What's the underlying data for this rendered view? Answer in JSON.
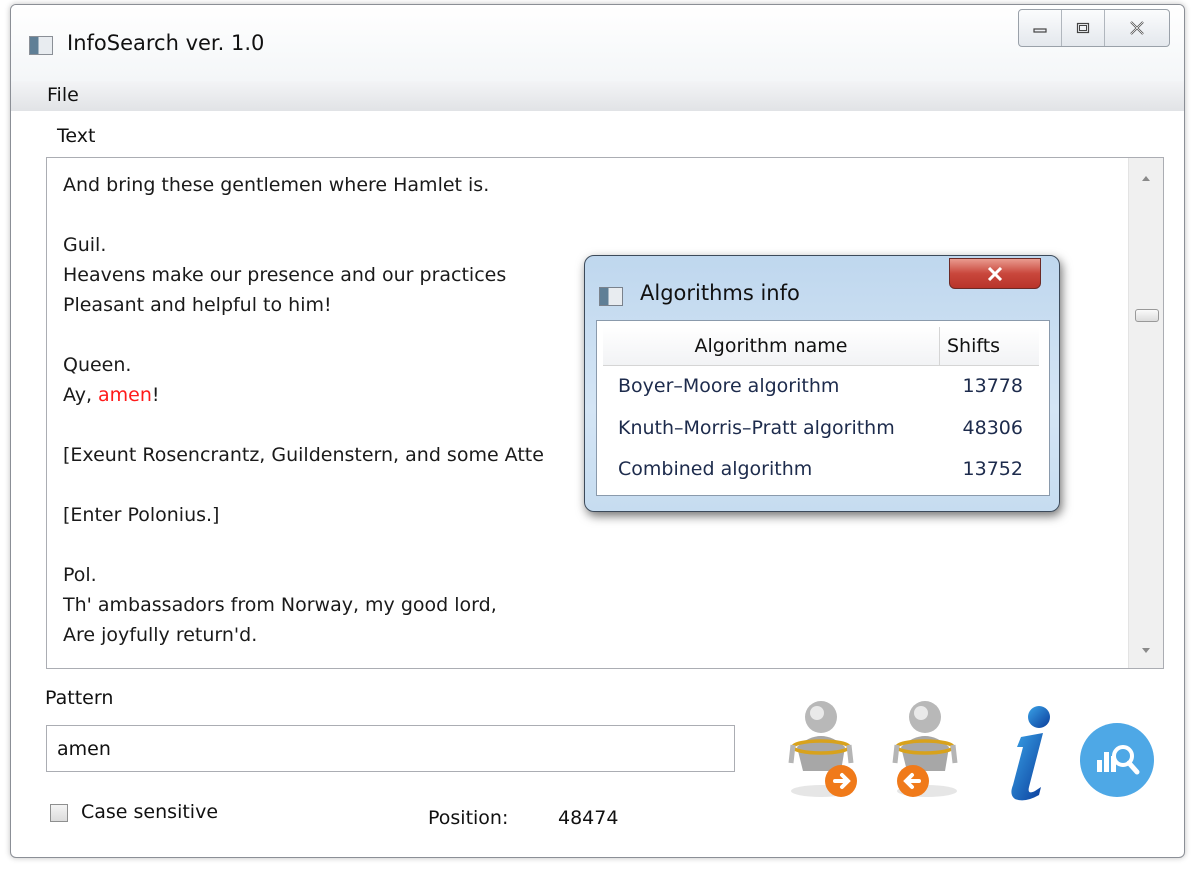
{
  "window": {
    "title": "InfoSearch ver. 1.0",
    "icons": [
      "app-icon",
      "minimize-icon",
      "maximize-icon",
      "close-icon"
    ]
  },
  "menu": {
    "file_label": "File"
  },
  "text_panel": {
    "label": "Text",
    "lines": [
      {
        "text": "And bring these gentlemen where Hamlet is."
      },
      {
        "text": ""
      },
      {
        "text": "Guil."
      },
      {
        "text": "Heavens make our presence and our practices"
      },
      {
        "text": "Pleasant and helpful to him!"
      },
      {
        "text": ""
      },
      {
        "text": "Queen."
      },
      {
        "pre": "Ay, ",
        "match": "amen",
        "post": "!"
      },
      {
        "text": ""
      },
      {
        "text": "[Exeunt Rosencrantz, Guildenstern, and some Atte"
      },
      {
        "text": ""
      },
      {
        "text": "[Enter Polonius.]"
      },
      {
        "text": ""
      },
      {
        "text": "Pol."
      },
      {
        "text": "Th' ambassadors from Norway, my good lord,"
      },
      {
        "text": "Are joyfully return'd."
      }
    ],
    "match_color": "#ff1a1a"
  },
  "pattern": {
    "label": "Pattern",
    "value": "amen"
  },
  "options": {
    "case_sensitive_label": "Case sensitive",
    "case_sensitive_checked": false
  },
  "status": {
    "position_label": "Position:",
    "position_value": "48474"
  },
  "toolbar": {
    "buttons": [
      {
        "icon": "search-next-icon"
      },
      {
        "icon": "search-previous-icon"
      },
      {
        "icon": "info-icon"
      },
      {
        "icon": "statistics-search-icon"
      }
    ]
  },
  "algorithms_dialog": {
    "title": "Algorithms info",
    "columns": [
      "Algorithm name",
      "Shifts"
    ],
    "rows": [
      {
        "name": "Boyer–Moore algorithm",
        "shifts": "13778"
      },
      {
        "name": "Knuth–Morris–Pratt algorithm",
        "shifts": "48306"
      },
      {
        "name": "Combined algorithm",
        "shifts": "13752"
      }
    ]
  }
}
